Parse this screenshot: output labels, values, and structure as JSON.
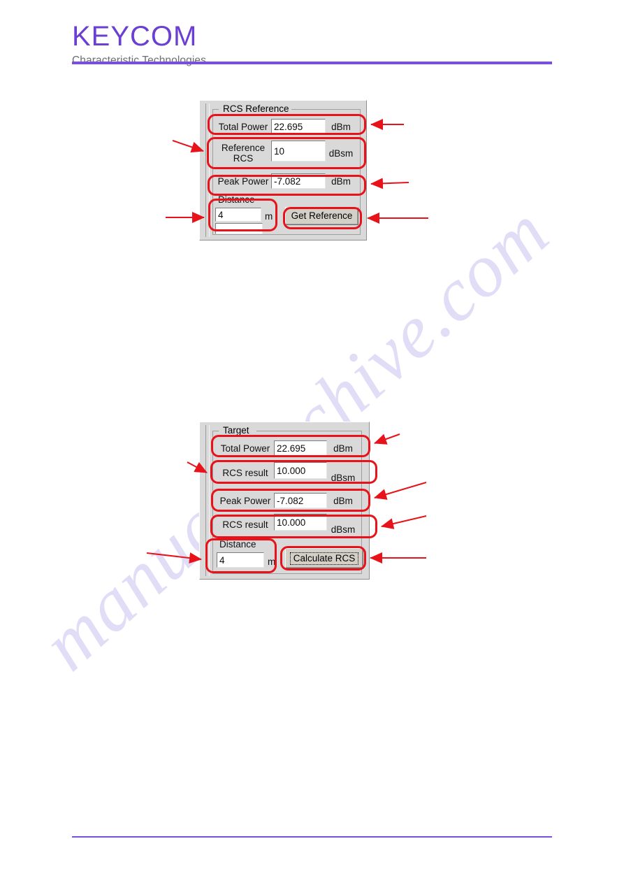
{
  "header": {
    "logo_main": "KEYCOM",
    "logo_sub": "Characteristic Technologies"
  },
  "watermark": {
    "text": "manualsarchive.com"
  },
  "panels": [
    {
      "id": "rcs-reference",
      "title": "RCS Reference",
      "rows": [
        {
          "label": "Total Power",
          "value": "22.695",
          "unit": "dBm"
        },
        {
          "label": "Reference\nRCS",
          "label_line1": "Reference",
          "label_line2": "RCS",
          "value": "10",
          "unit": "dBsm"
        },
        {
          "label": "Peak Power",
          "value": "-7.082",
          "unit": "dBm"
        }
      ],
      "distance": {
        "label": "Distance",
        "value": "4",
        "unit": "m"
      },
      "button": {
        "label": "Get Reference",
        "focused": false
      }
    },
    {
      "id": "target",
      "title": "Target",
      "rows": [
        {
          "label": "Total Power",
          "value": "22.695",
          "unit": "dBm"
        },
        {
          "label": "RCS result",
          "value": "10.000",
          "unit": "dBsm"
        },
        {
          "label": "Peak Power",
          "value": "-7.082",
          "unit": "dBm"
        },
        {
          "label": "RCS result",
          "value": "10.000",
          "unit": "dBsm"
        }
      ],
      "distance": {
        "label": "Distance",
        "value": "4",
        "unit": "m"
      },
      "button": {
        "label": "Calculate RCS",
        "focused": true
      }
    }
  ],
  "colors": {
    "brand_purple": "#7a4fdd",
    "annotation_red": "#e8131a",
    "panel_face": "#d9d9d9",
    "watermark": "#c9c2ef"
  }
}
